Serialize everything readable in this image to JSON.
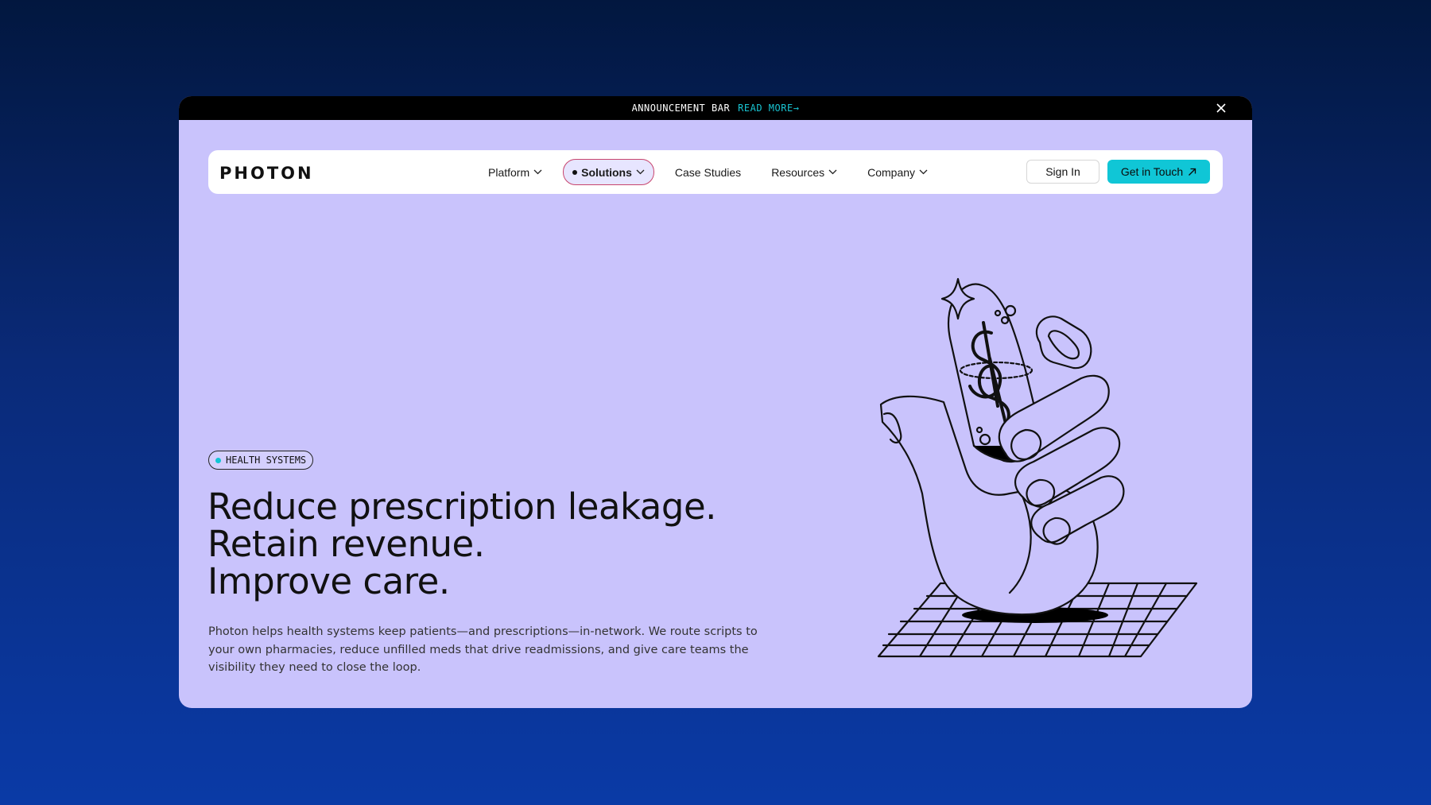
{
  "announcement": {
    "text": "ANNOUNCEMENT BAR",
    "link": "READ MORE→"
  },
  "brand": {
    "logo_text": "PHOTON"
  },
  "nav": {
    "items": [
      {
        "label": "Platform",
        "has_dropdown": true
      },
      {
        "label": "Solutions",
        "has_dropdown": true,
        "active": true
      },
      {
        "label": "Case Studies",
        "has_dropdown": false
      },
      {
        "label": "Resources",
        "has_dropdown": true
      },
      {
        "label": "Company",
        "has_dropdown": true
      }
    ],
    "signin_label": "Sign In",
    "cta_label": "Get in Touch"
  },
  "hero": {
    "badge": "HEALTH SYSTEMS",
    "headline": [
      "Reduce prescription leakage.",
      "Retain revenue.",
      "Improve care."
    ],
    "description": "Photon helps health systems keep patients—and prescriptions—in-network. We route scripts to your own pharmacies, reduce unfilled meds that drive readmissions, and give care teams the visibility they need to close the loop."
  },
  "colors": {
    "page_bg_top": "#02173f",
    "page_bg_bottom": "#0a3aa6",
    "panel_bg": "#c9c3fc",
    "accent": "#10c6d6",
    "announcement_bg": "#000000"
  }
}
